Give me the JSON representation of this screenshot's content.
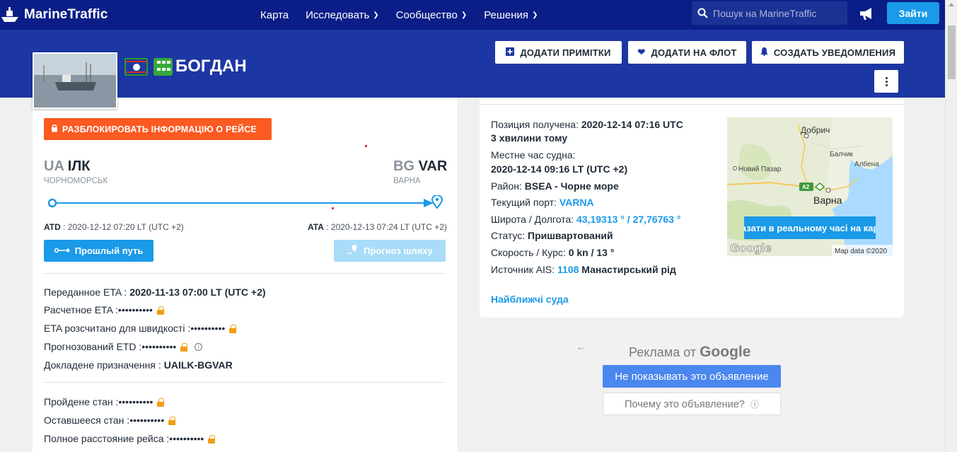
{
  "nav": {
    "brand": "MarineTraffic",
    "links": [
      {
        "label": "Карта",
        "dropdown": false
      },
      {
        "label": "Исследовать",
        "dropdown": true
      },
      {
        "label": "Сообщество",
        "dropdown": true
      },
      {
        "label": "Решения",
        "dropdown": true
      }
    ],
    "search_placeholder": "Пошук на MarineTraffic",
    "login_label": "Зайти"
  },
  "vessel": {
    "name": "БОГДАН",
    "buttons": {
      "add_notes": "ДОДАТИ ПРИМІТКИ",
      "add_fleet": "ДОДАТИ НА ФЛОТ",
      "create_alerts": "СОЗДАТЬ УВЕДОМЛЕНИЯ"
    }
  },
  "voyage": {
    "unlock_label": "РАЗБЛОКИРОВАТЬ ІНФОРМАЦІЮ О РЕЙСЕ",
    "departure": {
      "country": "UA",
      "code": "ІЛК",
      "name": "ЧОРНОМОРСЬК",
      "time_label": "ATD",
      "time": ": 2020-12-12 07:20 LT (UTC +2)"
    },
    "arrival": {
      "country": "BG",
      "code": "VAR",
      "name": "ВАРНА",
      "time_label": "ATA",
      "time": ": 2020-12-13 07:24 LT (UTC +2)"
    },
    "past_track_label": "Прошлый путь",
    "route_forecast_label": "Прогноз шляху",
    "reported_eta_label": "Переданное ETA :",
    "reported_eta": "2020-11-13 07:00 LT (UTC +2)",
    "calc_eta_label": "Расчетное ETA :",
    "speed_eta_label": "ETA розсчитано для швидкості :",
    "pred_etd_label": "Прогнозований ETD :",
    "reported_dest_label": "Докладене призначення :",
    "reported_dest": "UAILK-BGVAR",
    "distance_travelled_label": "Пройдене стан :",
    "distance_remaining_label": "Оставшееся стан :",
    "total_distance_label": "Полное расстояние рейса :",
    "masked": "••••••••••"
  },
  "position": {
    "received_label": "Позиция получена:",
    "received": "2020-12-14 07:16 UTC",
    "ago": "3 хвилини тому",
    "local_time_label": "Местне час судна:",
    "local_time": "2020-12-14 09:16 LT (UTC +2)",
    "area_label": "Район:",
    "area": "BSEA - Чорне море",
    "port_label": "Текущий порт:",
    "port": "VARNA",
    "latlon_label": "Широта / Долгота:",
    "latlon": "43,19313 ° / 27,76763 °",
    "status_label": "Статус:",
    "status": "Пришвартований",
    "speed_label": "Скорость / Курс:",
    "speed": "0 kn / 13 °",
    "ais_label": "Источник AIS:",
    "ais_id": "1108",
    "ais_name": "Манастирський рід",
    "nearest_label": "Найближчі суда"
  },
  "map": {
    "towns": [
      "Добрич",
      "Балчик",
      "Албена",
      "Новий Пазар",
      "Варна"
    ],
    "road_badge": "A2",
    "realtime_btn": "Показати в реальному часі на карті",
    "google": "Google",
    "attribution": "Map data ©2020"
  },
  "ad": {
    "title_prefix": "Реклама от",
    "title_brand": "Google",
    "hide_label": "Не показывать это объявление",
    "why_label": "Почему это объявление?"
  },
  "colors": {
    "nav_bg": "#0b1e87",
    "header_bg": "#1c36a3",
    "accent": "#1a9ae8",
    "unlock": "#fb5a22",
    "lock": "#f39c12"
  }
}
